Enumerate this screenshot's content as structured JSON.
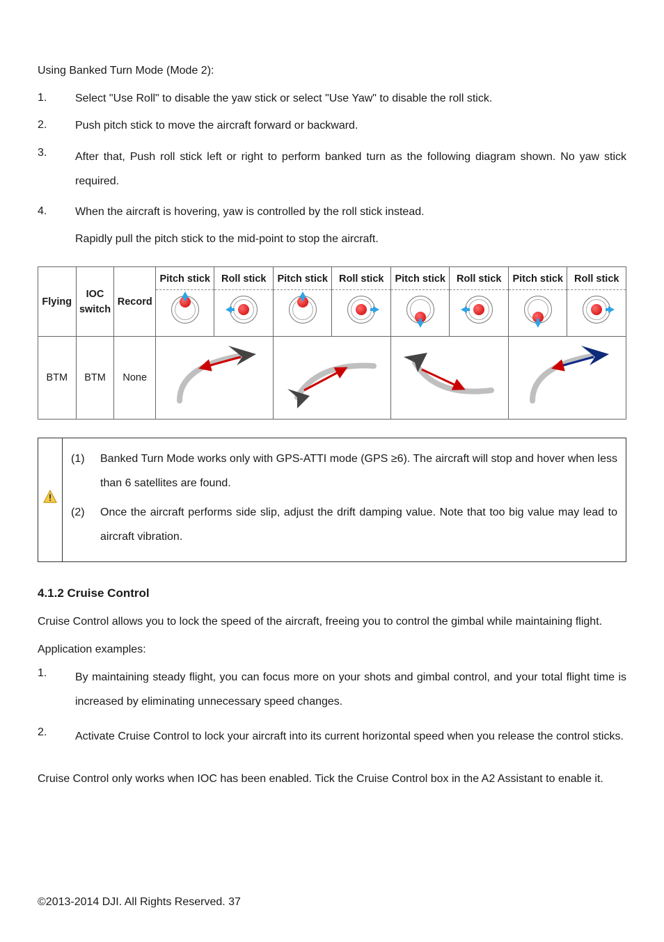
{
  "intro": "Using Banked Turn Mode (Mode 2):",
  "steps": [
    {
      "n": "1.",
      "t": "Select \"Use Roll\" to disable the yaw stick or select \"Use Yaw\" to disable the roll stick."
    },
    {
      "n": "2.",
      "t": "Push pitch stick to move the aircraft forward or backward."
    },
    {
      "n": "3.",
      "t": "After that, Push roll stick left or right to perform banked turn as the following diagram shown. No yaw stick required."
    },
    {
      "n": "4.",
      "t": "When the aircraft is hovering, yaw is controlled by the roll stick instead."
    }
  ],
  "trailing_step": "Rapidly pull the pitch stick to the mid-point to stop the aircraft.",
  "table": {
    "row1_left": "Flying",
    "row1_ioc": "IOC switch",
    "row1_record": "Record",
    "headers": [
      "Pitch stick",
      "Roll stick",
      "Pitch stick",
      "Roll stick",
      "Pitch stick",
      "Roll stick",
      "Pitch stick",
      "Roll stick"
    ],
    "stick_states": [
      {
        "knob": "up",
        "arrow": "up"
      },
      {
        "knob": "center",
        "arrow": "left"
      },
      {
        "knob": "up",
        "arrow": "up"
      },
      {
        "knob": "center",
        "arrow": "right"
      },
      {
        "knob": "down",
        "arrow": "down"
      },
      {
        "knob": "center",
        "arrow": "left"
      },
      {
        "knob": "down",
        "arrow": "down"
      },
      {
        "knob": "center",
        "arrow": "right"
      }
    ],
    "row2_left": "BTM",
    "row2_ioc": "BTM",
    "row2_record": "None"
  },
  "warnings": [
    {
      "n": "(1)",
      "t": "Banked Turn Mode works only with GPS-ATTI mode (GPS ≥6). The aircraft will stop and hover when less than 6 satellites are found."
    },
    {
      "n": "(2)",
      "t": "Once the aircraft performs side slip, adjust the drift damping value. Note that too big value may lead to aircraft vibration."
    }
  ],
  "section_heading": "4.1.2 Cruise Control",
  "cruise_intro": "Cruise Control allows you to lock the speed of the aircraft, freeing you to control the gimbal while maintaining flight.",
  "examples_heading": "Application examples:",
  "examples": [
    {
      "n": "1.",
      "t": "By maintaining steady flight, you can focus more on your shots and gimbal control, and your total flight time is increased by eliminating unnecessary speed changes."
    },
    {
      "n": "2.",
      "t": "Activate Cruise Control to lock your aircraft into its current horizontal speed when you release the control sticks."
    }
  ],
  "cruise_note": "Cruise Control only works when IOC has been enabled. Tick the Cruise Control box in the A2 Assistant to enable it.",
  "footer": "©2013-2014 DJI. All Rights Reserved.    37"
}
